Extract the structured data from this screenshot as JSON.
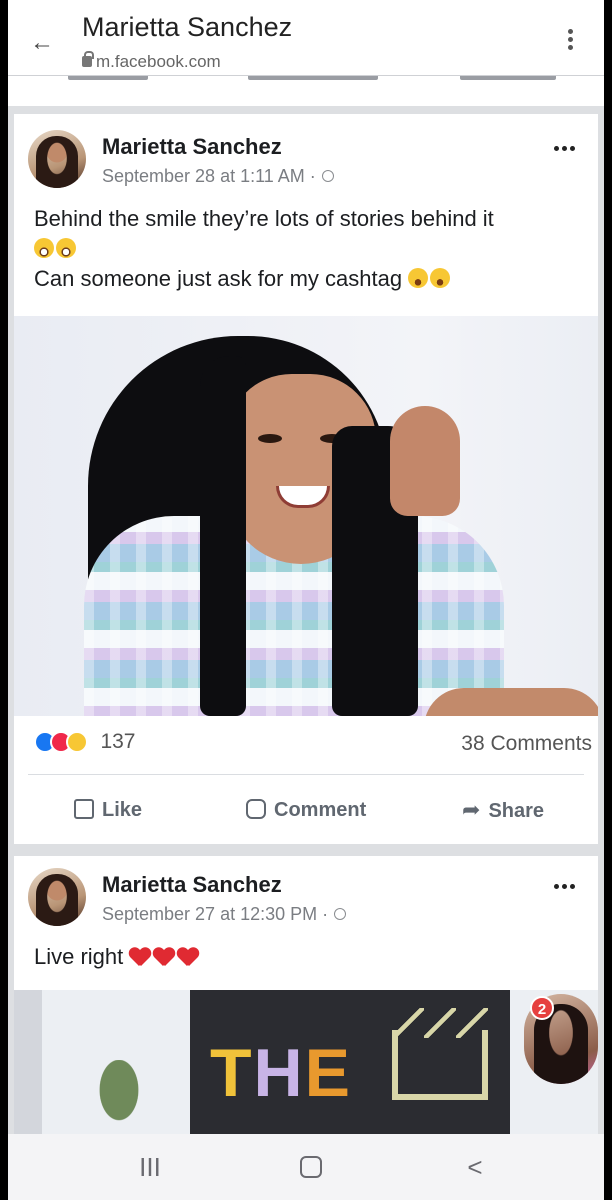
{
  "browser": {
    "title": "Marietta Sanchez",
    "url": "m.facebook.com",
    "back_icon": "←"
  },
  "posts": [
    {
      "author": "Marietta Sanchez",
      "time": "September 28 at 1:11 AM ·",
      "text_line1": "Behind the smile they’re lots of stories behind it",
      "text_line2": "Can someone just ask for my cashtag",
      "reaction_count": "137",
      "comment_count": "38 Comments",
      "actions": {
        "like": "Like",
        "comment": "Comment",
        "share": "Share"
      }
    },
    {
      "author": "Marietta Sanchez",
      "time": "September 27 at 12:30 PM ·",
      "text": "Live right",
      "sign_text": [
        "T",
        "H",
        "E"
      ]
    }
  ],
  "chat_head": {
    "badge": "2"
  },
  "nav": {
    "recent": "III",
    "back": "<"
  },
  "colors": {
    "accent": "#1877f2",
    "love": "#f0284a",
    "badge": "#e6403f"
  }
}
